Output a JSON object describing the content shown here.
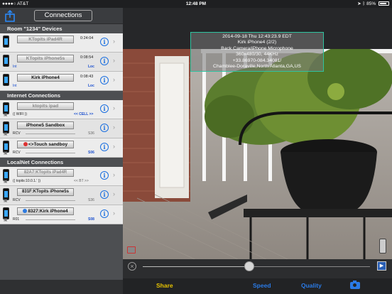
{
  "status": {
    "carrier": "●●●●○ AT&T",
    "time": "12:48 PM",
    "battery": "85%",
    "battery_level": 0.85
  },
  "nav": {
    "title": "Connections"
  },
  "sections": [
    {
      "header": "Room \"1234\" Devices",
      "rows": [
        {
          "name": "KTopits iPad4R",
          "muted": true,
          "time": "0:24:04",
          "sub_left": "",
          "sub_right": ""
        },
        {
          "name": "KTopits iPhone5s",
          "muted": true,
          "time": "0:08:54",
          "sub_left": "Int",
          "sub_right": "Loc"
        },
        {
          "name": "Kirk iPhone4",
          "muted": false,
          "time": "0:08:43",
          "sub_left": "Int",
          "sub_right": "Loc"
        }
      ]
    },
    {
      "header": "Internet Connections",
      "rows": [
        {
          "name": "ktopits ipad",
          "muted": true,
          "sub_left": "(( WIFI ))",
          "sub_mid": "<< CELL >>"
        },
        {
          "name": "iPhone5 Sandbox",
          "muted": false,
          "sub_left": "RCV",
          "sub_right": "S36"
        },
        {
          "name": "<>Touch sandboy",
          "muted": false,
          "sub_left": "RCV",
          "sub_right": "S06"
        }
      ]
    },
    {
      "header": "LocalNet Connections",
      "rows": [
        {
          "name": "82A7:KTopits iPad4R",
          "muted": true,
          "sub_left": "(( topits:10.0.1.' ))",
          "sub_mid": "<< BT >>"
        },
        {
          "name": "831F:KTopits iPhone5s",
          "muted": false,
          "sub_left": "RCV",
          "sub_right": "S36"
        },
        {
          "name": "8327:Kirk iPhone4",
          "muted": false,
          "sub_left": "R01",
          "sub_right": "S08"
        }
      ]
    }
  ],
  "overlay": {
    "line1": "2014-09-18 Thu 12:43:23.9 EDT",
    "line2": "Kirk iPhone4 (2/2)",
    "line3": "Back Camera/iPhone Microphone",
    "line4": "360x480/30, 44KHz",
    "line5": "+33.86970-084.34081/",
    "line6": "Chamblee-Doraville,North Atlanta,GA,US"
  },
  "playback": {
    "position": 0.47
  },
  "toolbar": {
    "share": "Share",
    "speed": "Speed",
    "quality": "Quality"
  },
  "colors": {
    "accent": "#1a6fe0",
    "share": "#e6c200",
    "overlay_border": "#2fc3a0"
  }
}
